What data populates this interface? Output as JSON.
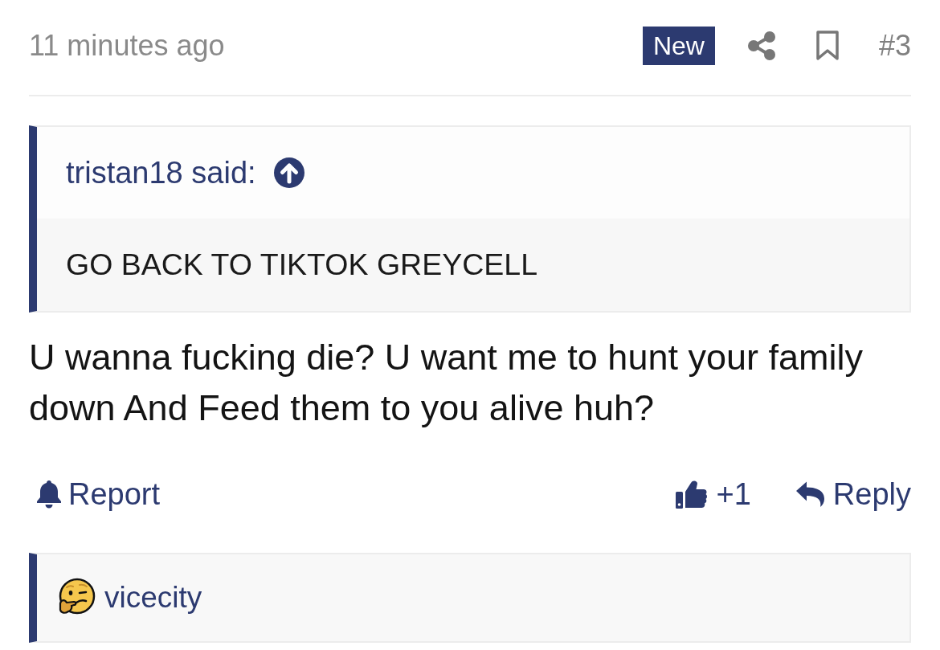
{
  "post": {
    "time": "11 minutes ago",
    "badge": "New",
    "bookmarked": false,
    "number": "#3"
  },
  "quote": {
    "author": "tristan18 said:",
    "text": "GO BACK TO TIKTOK GREYCELL"
  },
  "message": "U wanna fucking die? U want me to hunt your family down And Feed them to you alive huh?",
  "actions": {
    "report": "Report",
    "like_count": "+1",
    "reply": "Reply"
  },
  "next_quote": {
    "author": "vicecity"
  }
}
